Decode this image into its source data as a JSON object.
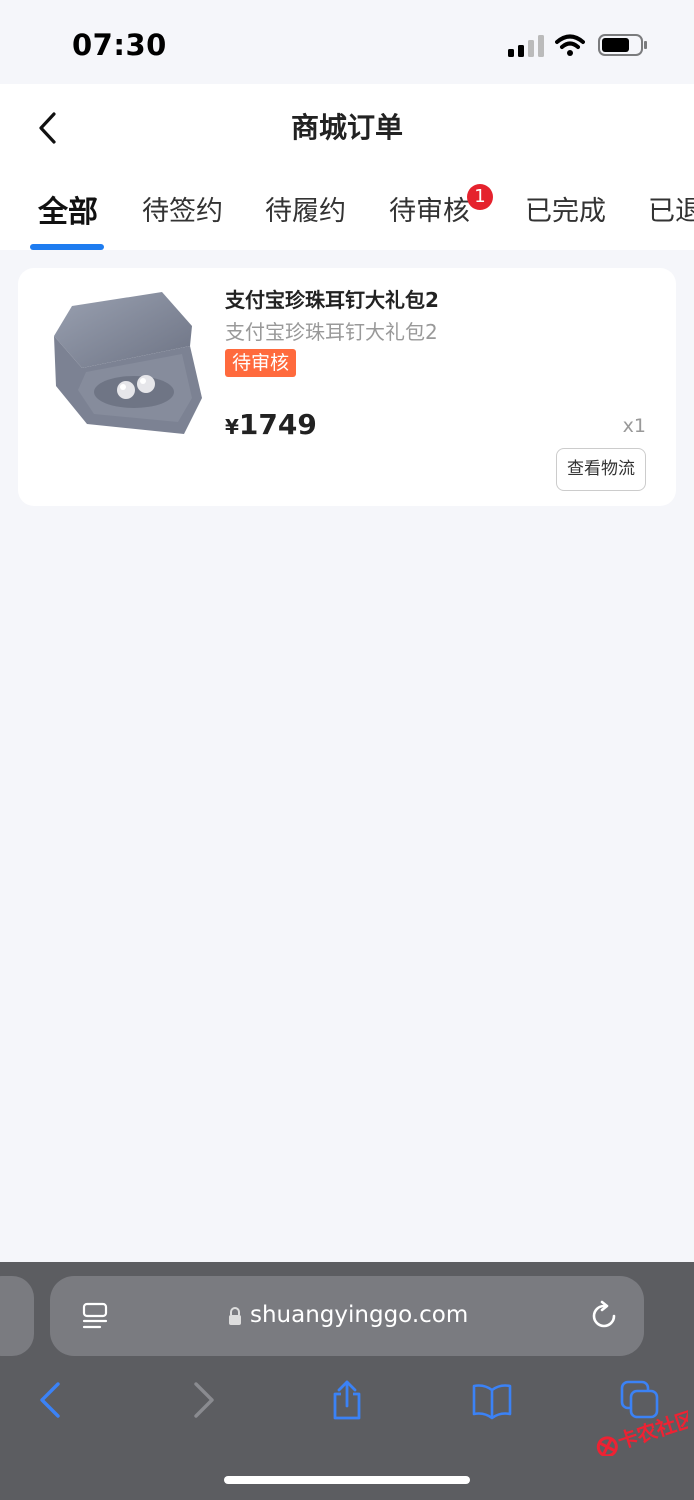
{
  "status_bar": {
    "time": "07:30"
  },
  "header": {
    "title": "商城订单",
    "tabs": [
      {
        "label": "全部",
        "active": true
      },
      {
        "label": "待签约",
        "active": false
      },
      {
        "label": "待履约",
        "active": false
      },
      {
        "label": "待审核",
        "active": false,
        "badge": "1"
      },
      {
        "label": "已完成",
        "active": false
      },
      {
        "label": "已退",
        "active": false
      }
    ]
  },
  "order": {
    "product_name": "支付宝珍珠耳钉大礼包2",
    "product_subtitle": "支付宝珍珠耳钉大礼包2",
    "status": "待审核",
    "currency": "¥",
    "price": "1749",
    "quantity": "x1",
    "action_label": "查看物流"
  },
  "browser": {
    "url": "shuangyinggo.com"
  },
  "watermark": {
    "text": "卡农社区"
  },
  "colors": {
    "accent": "#1e7cf0",
    "badge": "#e5222d",
    "status_tag": "#ff6a3d",
    "browser_icon": "#3b82f6"
  }
}
